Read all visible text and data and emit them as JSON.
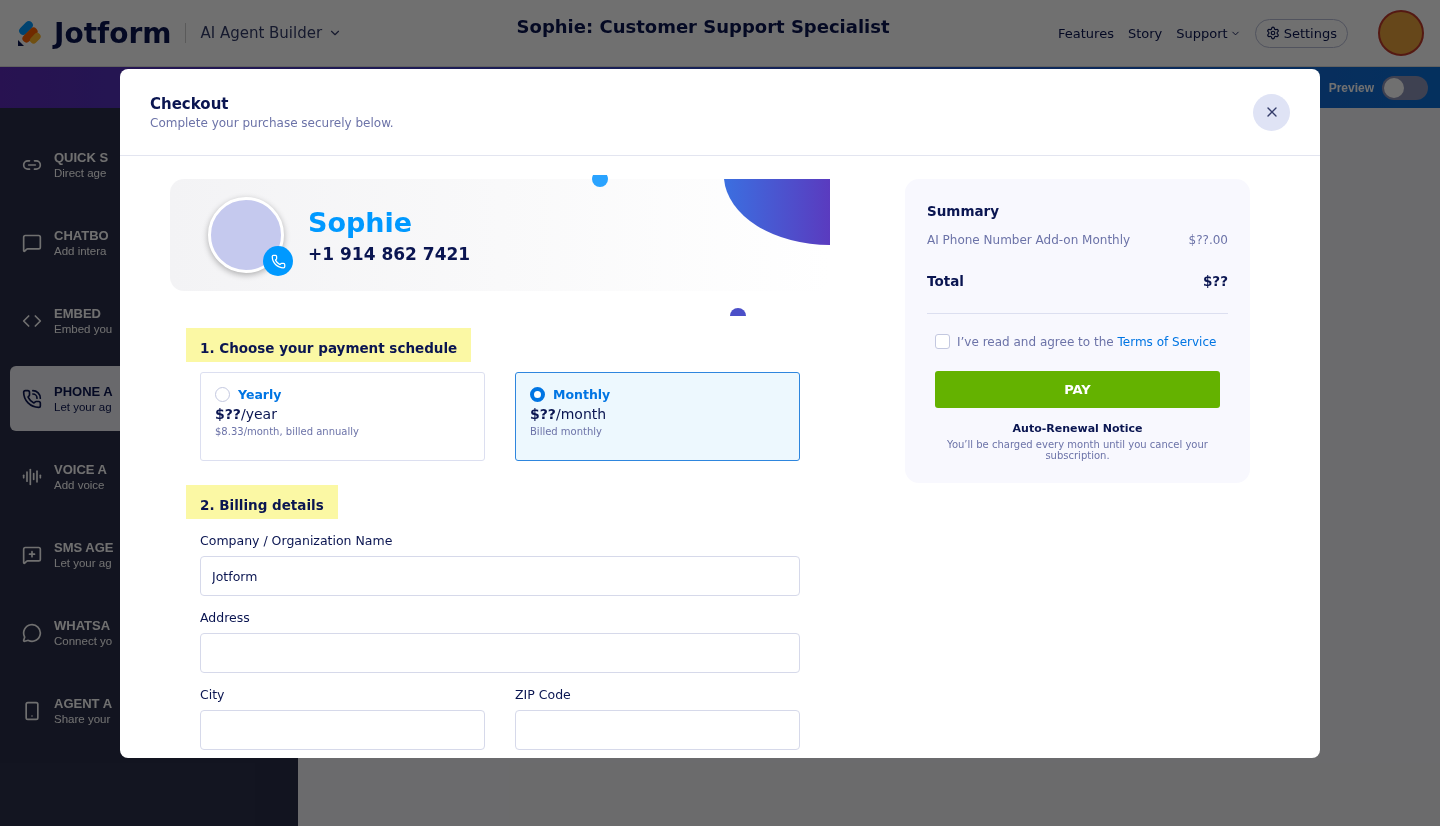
{
  "header": {
    "logo": "Jotform",
    "product": "AI Agent Builder",
    "title": "Sophie: Customer Support Specialist",
    "nav": [
      {
        "label": "Features",
        "kind": "link"
      },
      {
        "label": "Story",
        "kind": "link"
      },
      {
        "label": "Support",
        "kind": "menu"
      }
    ],
    "settings": "Settings"
  },
  "preview": {
    "label": "Preview",
    "on": false
  },
  "sidebar": {
    "items": [
      {
        "title": "QUICK S",
        "subtitle": "Direct age",
        "selected": false
      },
      {
        "title": "CHATBO",
        "subtitle": "Add intera",
        "selected": false
      },
      {
        "title": "EMBED",
        "subtitle": "Embed you",
        "selected": false
      },
      {
        "title": "PHONE A",
        "subtitle": "Let your ag",
        "selected": true
      },
      {
        "title": "VOICE A",
        "subtitle": "Add voice",
        "selected": false
      },
      {
        "title": "SMS AGE",
        "subtitle": "Let your ag",
        "selected": false
      },
      {
        "title": "WHATSA",
        "subtitle": "Connect yo",
        "selected": false
      },
      {
        "title": "AGENT A",
        "subtitle": "Share your",
        "selected": false
      }
    ]
  },
  "checkout": {
    "title": "Checkout",
    "subtitle": "Complete your purchase securely below.",
    "agent": {
      "name": "Sophie",
      "phone": "+1 914 862 7421"
    },
    "schedule": {
      "heading": "1. Choose your payment schedule",
      "plans": [
        {
          "name": "Yearly",
          "price": "**$??**/year",
          "note": "$8.33/month, billed annually",
          "selected": false
        },
        {
          "name": "Monthly",
          "price": "**$??**/month",
          "note": "Billed monthly",
          "selected": true
        }
      ]
    },
    "billing": {
      "heading": "2. Billing details",
      "fields": [
        {
          "label": "Company / Organization Name",
          "value": "Jotform"
        },
        {
          "label": "Address"
        },
        {
          "label": "City"
        },
        {
          "label": "ZIP Code"
        }
      ]
    },
    "summary": {
      "title": "Summary",
      "items": [
        {
          "name": "AI Phone Number Add-on Monthly",
          "price": "$??.00"
        }
      ],
      "total_label": "Total",
      "total": "$??",
      "terms": {
        "text": "I’ve read and agree to the",
        "link": "Terms of Service",
        "checked": false
      },
      "pay": "PAY",
      "notice_title": "Auto-Renewal Notice",
      "notice": "You’ll be charged every month until you cancel your subscription."
    }
  }
}
